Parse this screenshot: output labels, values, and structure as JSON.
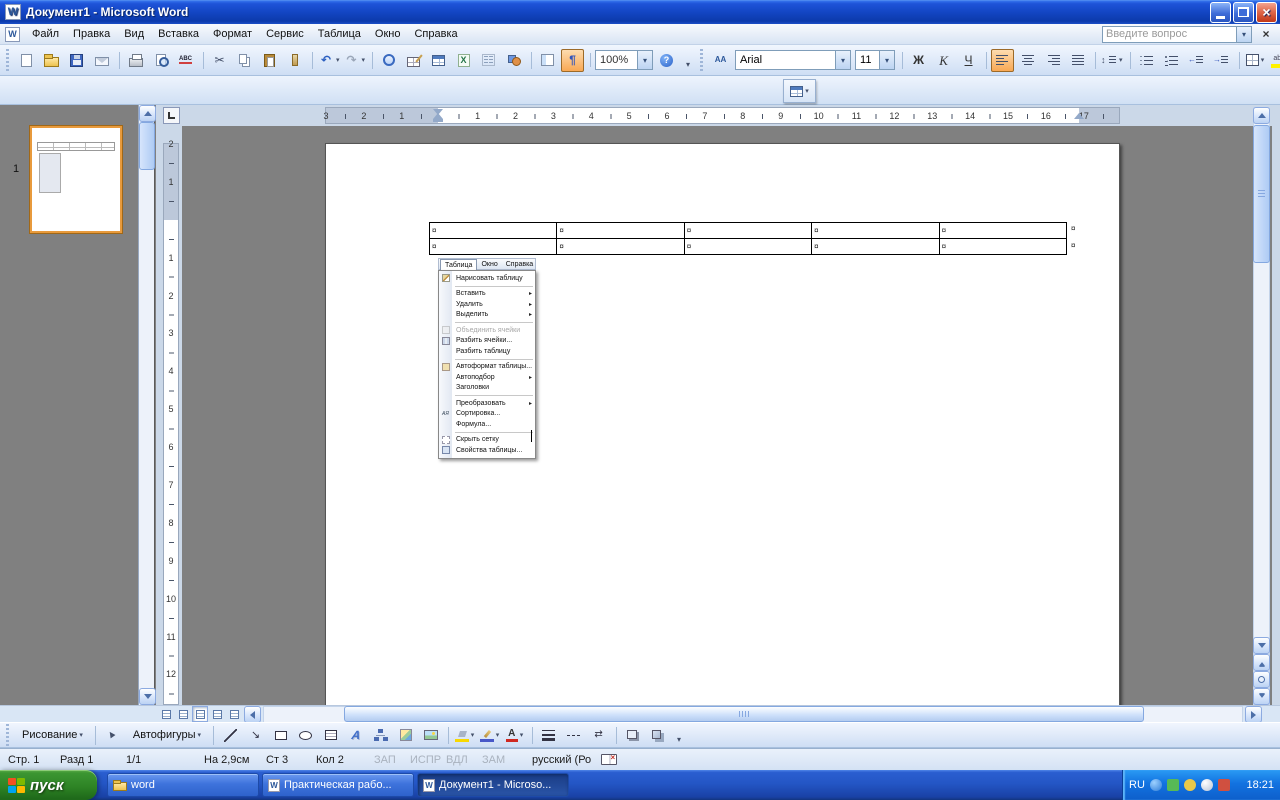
{
  "colors": {
    "titlebar_blue": "#1346C4",
    "toolbar_background": "#D8E5F5",
    "canvas_gray": "#808080",
    "active_toggle_orange": "#F9A854",
    "taskbar_blue": "#2456C5",
    "start_button_green": "#2E8425",
    "thumbnail_selected_border": "#E89A3C"
  },
  "titlebar": {
    "title": "Документ1 - Microsoft Word"
  },
  "menubar": {
    "items": [
      "Файл",
      "Правка",
      "Вид",
      "Вставка",
      "Формат",
      "Сервис",
      "Таблица",
      "Окно",
      "Справка"
    ],
    "ask_placeholder": "Введите вопрос"
  },
  "standard_toolbar": {
    "buttons": [
      {
        "name": "new-document-button",
        "icon": "new"
      },
      {
        "name": "open-button",
        "icon": "open"
      },
      {
        "name": "save-button",
        "icon": "save"
      },
      {
        "name": "email-button",
        "icon": "mail"
      },
      {
        "name": "print-button",
        "icon": "print",
        "sep": true
      },
      {
        "name": "print-preview-button",
        "icon": "preview"
      },
      {
        "name": "spelling-button",
        "icon": "spell"
      },
      {
        "name": "cut-button",
        "icon": "cut",
        "glyph": "✂",
        "sep": true
      },
      {
        "name": "copy-button",
        "icon": "copy"
      },
      {
        "name": "paste-button",
        "icon": "paste"
      },
      {
        "name": "format-painter-button",
        "icon": "painter"
      },
      {
        "name": "undo-button",
        "icon": "undo",
        "glyph": "↶",
        "dropdown": true,
        "sep": true
      },
      {
        "name": "redo-button",
        "icon": "redo",
        "glyph": "↷",
        "dropdown": true
      },
      {
        "name": "insert-hyperlink-button",
        "icon": "link",
        "sep": true
      },
      {
        "name": "tables-and-borders-button",
        "icon": "tblb"
      },
      {
        "name": "insert-table-button",
        "icon": "instable"
      },
      {
        "name": "insert-excel-button",
        "icon": "excel",
        "glyph": "X"
      },
      {
        "name": "columns-button",
        "icon": "columns"
      },
      {
        "name": "drawing-button",
        "icon": "shapes"
      },
      {
        "name": "document-map-button",
        "icon": "docmap",
        "sep": true
      },
      {
        "name": "show-hide-marks-button",
        "icon": "para",
        "glyph": "¶",
        "active": true
      },
      {
        "name": "zoom-select",
        "icon": "zoom",
        "glyph": "100%",
        "dropdown": true,
        "sep": true
      },
      {
        "name": "help-button",
        "icon": "help",
        "glyph": "?"
      }
    ]
  },
  "formatting_toolbar": {
    "font": "Arial",
    "size": "11",
    "buttons": [
      {
        "name": "bold-button",
        "icon": "bold",
        "glyph": "Ж",
        "sep": true
      },
      {
        "name": "italic-button",
        "icon": "italic",
        "glyph": "К"
      },
      {
        "name": "underline-button",
        "icon": "underline",
        "glyph": "Ч"
      },
      {
        "name": "align-left-button",
        "icon": "alignl",
        "active": true,
        "sep": true
      },
      {
        "name": "align-center-button",
        "icon": "alignc"
      },
      {
        "name": "align-right-button",
        "icon": "alignr"
      },
      {
        "name": "justify-button",
        "icon": "alignj"
      },
      {
        "name": "line-spacing-button",
        "icon": "linespace",
        "dropdown": true,
        "sep": true
      },
      {
        "name": "numbering-button",
        "icon": "numlist",
        "sep": true
      },
      {
        "name": "bullets-button",
        "icon": "bullist"
      },
      {
        "name": "decrease-indent-button",
        "icon": "outdent"
      },
      {
        "name": "increase-indent-button",
        "icon": "indent"
      },
      {
        "name": "borders-button",
        "icon": "borders",
        "dropdown": true,
        "sep": true
      },
      {
        "name": "highlight-button",
        "icon": "highlight",
        "dropdown": true
      },
      {
        "name": "font-color-button",
        "icon": "fontcolor",
        "glyph": "А",
        "dropdown": true
      }
    ]
  },
  "mini_toolbar": {
    "buttons": [
      {
        "name": "insert-table-mini-button",
        "icon": "instable",
        "dropdown": true
      }
    ]
  },
  "rulers": {
    "horizontal": [
      "3",
      "2",
      "1",
      "",
      "1",
      "2",
      "3",
      "4",
      "5",
      "6",
      "7",
      "8",
      "9",
      "10",
      "11",
      "12",
      "13",
      "14",
      "15",
      "16",
      "17"
    ],
    "vertical": [
      "2",
      "1",
      "",
      "1",
      "2",
      "3",
      "4",
      "5",
      "6",
      "7",
      "8",
      "9",
      "10",
      "11",
      "12"
    ]
  },
  "thumbnails": {
    "page_number": "1"
  },
  "document": {
    "table": {
      "rows": 2,
      "cols": 5,
      "marker": "¤"
    },
    "menu_shot": {
      "bar": [
        "Таблица",
        "Окно",
        "Справка"
      ],
      "items": [
        {
          "label": "Нарисовать таблицу",
          "icon": "draw",
          "sep_after": true
        },
        {
          "label": "Вставить",
          "submenu": true
        },
        {
          "label": "Удалить",
          "submenu": true
        },
        {
          "label": "Выделить",
          "submenu": true,
          "sep_after": true
        },
        {
          "label": "Объединить ячейки",
          "icon": "merge",
          "disabled": true
        },
        {
          "label": "Разбить ячейки...",
          "icon": "splitc"
        },
        {
          "label": "Разбить таблицу",
          "sep_after": true
        },
        {
          "label": "Автоформат таблицы...",
          "icon": "autofmt"
        },
        {
          "label": "Автоподбор",
          "submenu": true
        },
        {
          "label": "Заголовки",
          "sep_after": true
        },
        {
          "label": "Преобразовать",
          "submenu": true
        },
        {
          "label": "Сортировка...",
          "icon": "sort"
        },
        {
          "label": "Формула...",
          "sep_after": true
        },
        {
          "label": "Скрыть сетку",
          "icon": "grid"
        },
        {
          "label": "Свойства таблицы...",
          "icon": "props"
        }
      ]
    }
  },
  "status_bar": {
    "fields": [
      {
        "text": "Стр. 1"
      },
      {
        "text": "Разд 1"
      },
      {
        "text": "1/1"
      },
      {
        "text": "На 2,9см"
      },
      {
        "text": "Ст 3"
      },
      {
        "text": "Кол 2"
      },
      {
        "text": "ЗАП",
        "dim": true
      },
      {
        "text": "ИСПР",
        "dim": true
      },
      {
        "text": "ВДЛ",
        "dim": true
      },
      {
        "text": "ЗАМ",
        "dim": true
      },
      {
        "text": "русский (Ро"
      }
    ]
  },
  "drawing_toolbar": {
    "draw_label": "Рисование",
    "autoshapes_label": "Автофигуры",
    "buttons": [
      {
        "name": "line-button",
        "icon": "line"
      },
      {
        "name": "arrow-button",
        "icon": "arrow",
        "glyph": "↘"
      },
      {
        "name": "rectangle-button",
        "icon": "rect"
      },
      {
        "name": "oval-button",
        "icon": "oval"
      },
      {
        "name": "text-box-button",
        "icon": "textbox"
      },
      {
        "name": "wordart-button",
        "icon": "wordart",
        "glyph": "А"
      },
      {
        "name": "diagram-button",
        "icon": "diagram"
      },
      {
        "name": "clipart-button",
        "icon": "clipart"
      },
      {
        "name": "insert-picture-button",
        "icon": "picture"
      },
      {
        "name": "fill-color-button",
        "icon": "fill",
        "dropdown": true,
        "sep": true
      },
      {
        "name": "line-color-button",
        "icon": "linecolor",
        "dropdown": true
      },
      {
        "name": "font-color-button",
        "icon": "fontcolor",
        "glyph": "А",
        "dropdown": true
      },
      {
        "name": "line-style-button",
        "icon": "linestyle",
        "sep": true
      },
      {
        "name": "dash-style-button",
        "icon": "dash"
      },
      {
        "name": "arrow-style-button",
        "icon": "arrowstyle",
        "glyph": "⇄"
      },
      {
        "name": "shadow-style-button",
        "icon": "shadow",
        "sep": true
      },
      {
        "name": "threed-style-button",
        "icon": "threed"
      }
    ]
  },
  "taskbar": {
    "start_label": "пуск",
    "tasks": [
      {
        "name": "taskbar-task-word-folder",
        "label": "word",
        "icon": "folder"
      },
      {
        "name": "taskbar-task-prakticheskaya",
        "label": "Практическая рабо...",
        "icon": "word"
      },
      {
        "name": "taskbar-task-dokument1",
        "label": "Документ1 - Microso...",
        "icon": "word",
        "active": true
      }
    ],
    "tray": {
      "lang": "RU",
      "time": "18:21"
    }
  }
}
